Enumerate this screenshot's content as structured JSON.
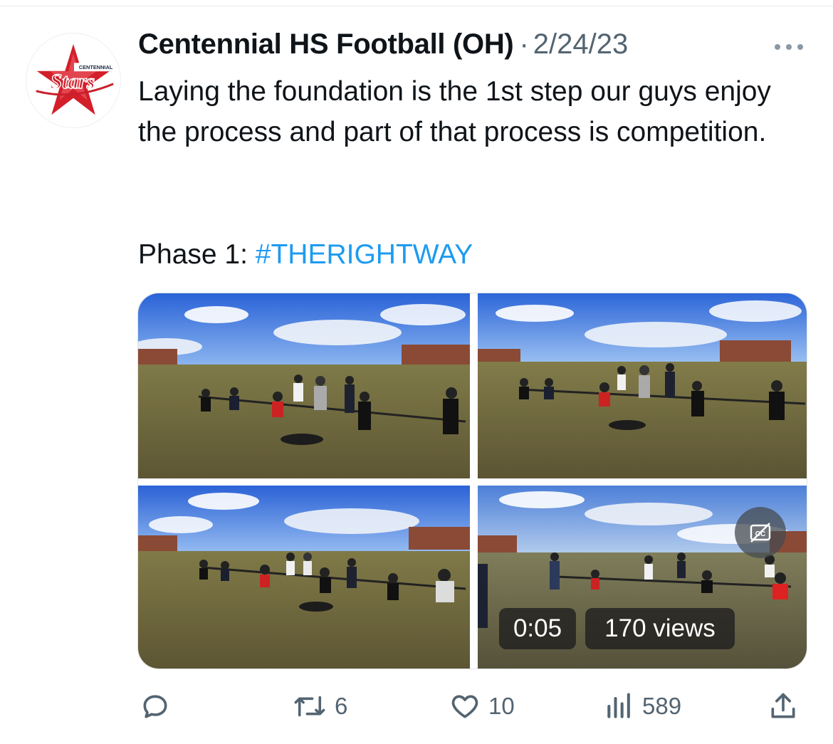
{
  "tweet": {
    "author": "Centennial HS Football (OH)",
    "separator": "·",
    "date": "2/24/23",
    "text": "Laying the foundation is the 1st step our guys enjoy the process and part of that process is competition.",
    "phase_prefix": "Phase 1: ",
    "hashtag": "#THERIGHTWAY"
  },
  "avatar": {
    "logo_top_text": "CENTENNIAL",
    "logo_script_text": "Stars",
    "star_color": "#d21f2a",
    "script_color": "#c8202a"
  },
  "media": {
    "video_time": "0:05",
    "video_views": "170 views",
    "icons": {
      "captions": "closed-captions-off-icon"
    }
  },
  "actions": {
    "reply": {
      "icon": "reply-icon",
      "count": ""
    },
    "retweet": {
      "icon": "retweet-icon",
      "count": "6"
    },
    "like": {
      "icon": "heart-icon",
      "count": "10"
    },
    "views": {
      "icon": "bar-chart-icon",
      "count": "589"
    },
    "share": {
      "icon": "share-icon"
    }
  },
  "colors": {
    "link": "#1d9bf0",
    "secondary_text": "#536471",
    "primary_text": "#0f1419"
  }
}
